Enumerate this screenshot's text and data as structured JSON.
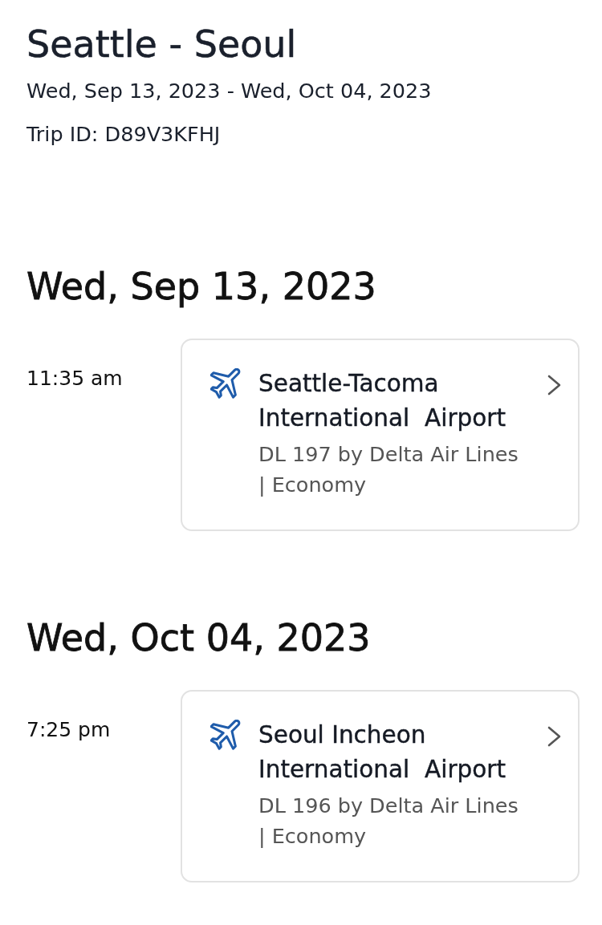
{
  "trip": {
    "title": "Seattle - Seoul",
    "dates": "Wed, Sep 13, 2023 - Wed, Oct 04, 2023",
    "trip_id": "Trip ID: D89V3KFHJ"
  },
  "days": [
    {
      "date": "Wed, Sep 13, 2023",
      "segments": [
        {
          "time": "11:35 am",
          "kind": "flight",
          "airport": "Seattle-Tacoma International  Airport",
          "details": "DL 197 by Delta Air Lines | Economy"
        }
      ]
    },
    {
      "date": "Wed, Oct 04, 2023",
      "segments": [
        {
          "time": "7:25 pm",
          "kind": "flight",
          "airport": "Seoul Incheon International  Airport",
          "details": "DL 196 by Delta Air Lines | Economy"
        }
      ]
    }
  ]
}
